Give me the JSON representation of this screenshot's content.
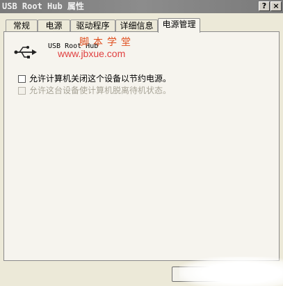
{
  "window": {
    "title": "USB Root Hub 属性",
    "help_label": "?",
    "close_label": "×"
  },
  "tabs": [
    {
      "label": "常规"
    },
    {
      "label": "电源"
    },
    {
      "label": "驱动程序"
    },
    {
      "label": "详细信息"
    },
    {
      "label": "电源管理",
      "active": true
    }
  ],
  "device": {
    "name": "USB Root Hub",
    "icon": "usb-icon"
  },
  "watermark": {
    "line1": "脚本学堂",
    "line2": "www.jbxue.com"
  },
  "options": [
    {
      "label": "允许计算机关闭这个设备以节约电源。",
      "checked": false,
      "enabled": true
    },
    {
      "label": "允许这台设备使计算机脱离待机状态。",
      "checked": false,
      "enabled": false
    }
  ],
  "colors": {
    "watermark": "#e05020",
    "panel_bg": "#f6f4ee",
    "dialog_bg": "#ece9d8",
    "disabled_text": "#a8a497"
  }
}
